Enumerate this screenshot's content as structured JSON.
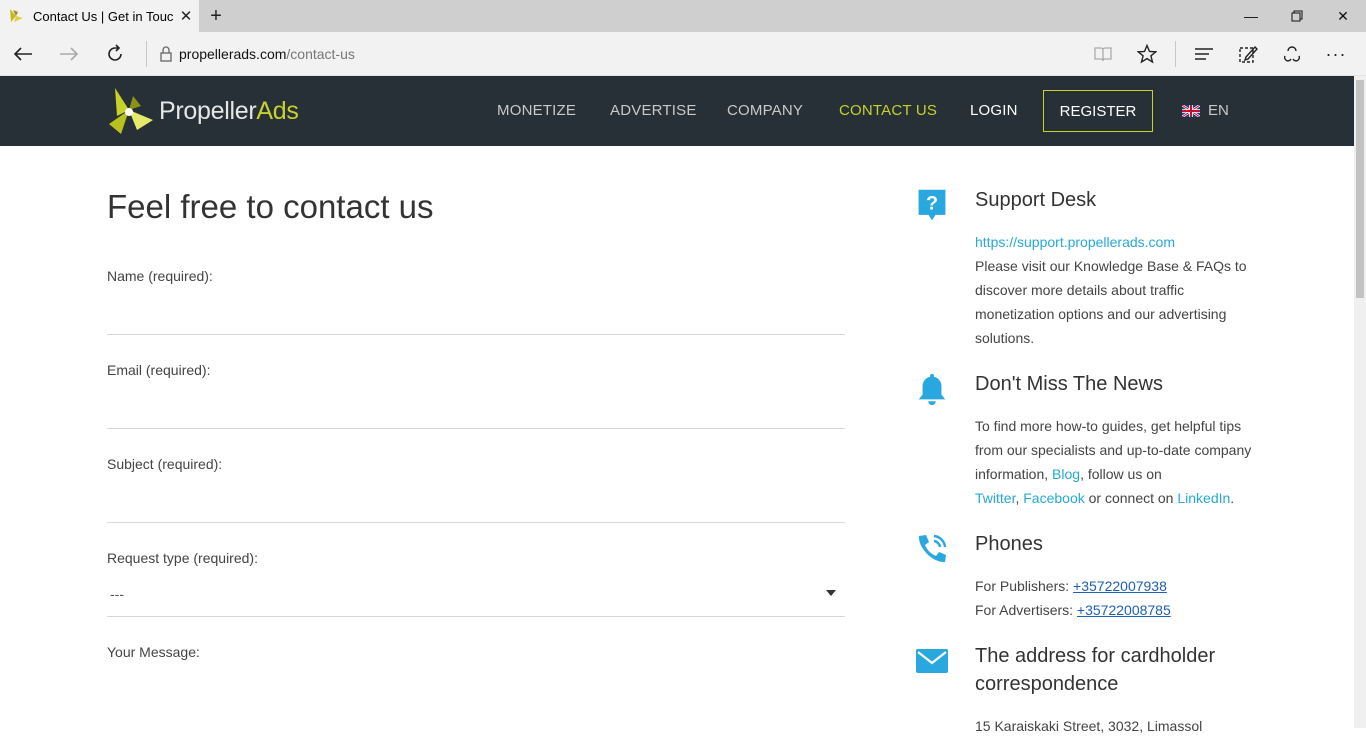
{
  "browser": {
    "tab_title": "Contact Us | Get in Touc",
    "url_domain": "propellerads.com",
    "url_path": "/contact-us"
  },
  "header": {
    "logo_text_main": "Propeller",
    "logo_text_accent": "Ads",
    "menu": {
      "monetize": "MONETIZE",
      "advertise": "ADVERTISE",
      "company": "COMPANY",
      "contact": "CONTACT US",
      "login": "LOGIN"
    },
    "register": "REGISTER",
    "language": "EN"
  },
  "form": {
    "title": "Feel free to contact us",
    "name_label": "Name (required):",
    "email_label": "Email (required):",
    "subject_label": "Subject (required):",
    "request_type_label": "Request type (required):",
    "request_type_value": "---",
    "message_label": "Your Message:"
  },
  "sidebar": {
    "support": {
      "title": "Support Desk",
      "link": "https://support.propellerads.com",
      "text": "Please visit our Knowledge Base & FAQs to discover more details about traffic monetization options and our advertising solutions."
    },
    "news": {
      "title": "Don't Miss The News",
      "text_before_blog": "To find more how-to guides, get helpful tips from our specialists and up-to-date company information, ",
      "blog": "Blog",
      "text_follow": ", follow us on",
      "twitter": "Twitter",
      "comma": ", ",
      "facebook": "Facebook",
      "connect": " or connect on ",
      "linkedin": "LinkedIn",
      "period": "."
    },
    "phones": {
      "title": "Phones",
      "publishers_label": "For Publishers: ",
      "publishers_number": "+35722007938",
      "advertisers_label": "For Advertisers: ",
      "advertisers_number": "+35722008785"
    },
    "address": {
      "title_line1": "The address for cardholder",
      "title_line2": "correspondence",
      "text": "15 Karaiskaki Street, 3032, Limassol"
    }
  },
  "colors": {
    "header_bg": "#263036",
    "accent_yellow": "#c8d12a",
    "link_blue": "#27a9d8",
    "icon_blue": "#29a8e0"
  }
}
